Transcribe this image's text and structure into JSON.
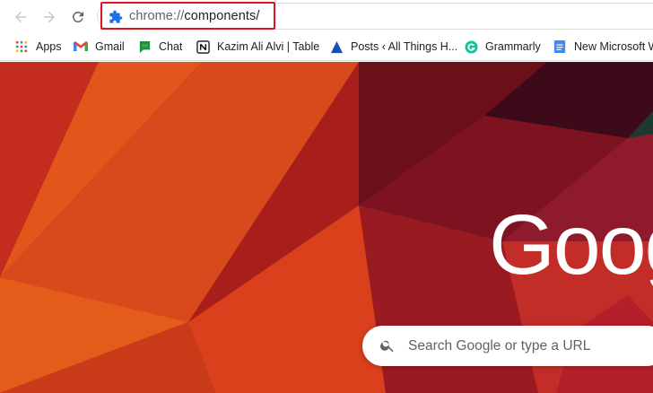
{
  "toolbar": {
    "back_icon": "arrow-left-icon",
    "forward_icon": "arrow-right-icon",
    "reload_icon": "reload-icon",
    "omnibox": {
      "icon": "puzzle-extension-icon",
      "scheme": "chrome://",
      "path": "components/",
      "highlight_color": "#e0141f"
    }
  },
  "bookmarks": [
    {
      "label": "Apps",
      "icon": "apps-grid-icon"
    },
    {
      "label": "Gmail",
      "icon": "gmail-icon"
    },
    {
      "label": "Chat",
      "icon": "chat-icon"
    },
    {
      "label": "Kazim Ali Alvi | Table",
      "icon": "notion-icon"
    },
    {
      "label": "Posts ‹ All Things H...",
      "icon": "triangle-icon"
    },
    {
      "label": "Grammarly",
      "icon": "grammarly-icon"
    },
    {
      "label": "New Microsoft W",
      "icon": "document-icon"
    }
  ],
  "ntp": {
    "logo_text": "Goog",
    "search_placeholder": "Search Google or type a URL",
    "search_icon": "search-icon"
  },
  "colors": {
    "accent_blue": "#1a73e8",
    "bg_red": "#a8141c",
    "bg_orange": "#e0521a"
  }
}
